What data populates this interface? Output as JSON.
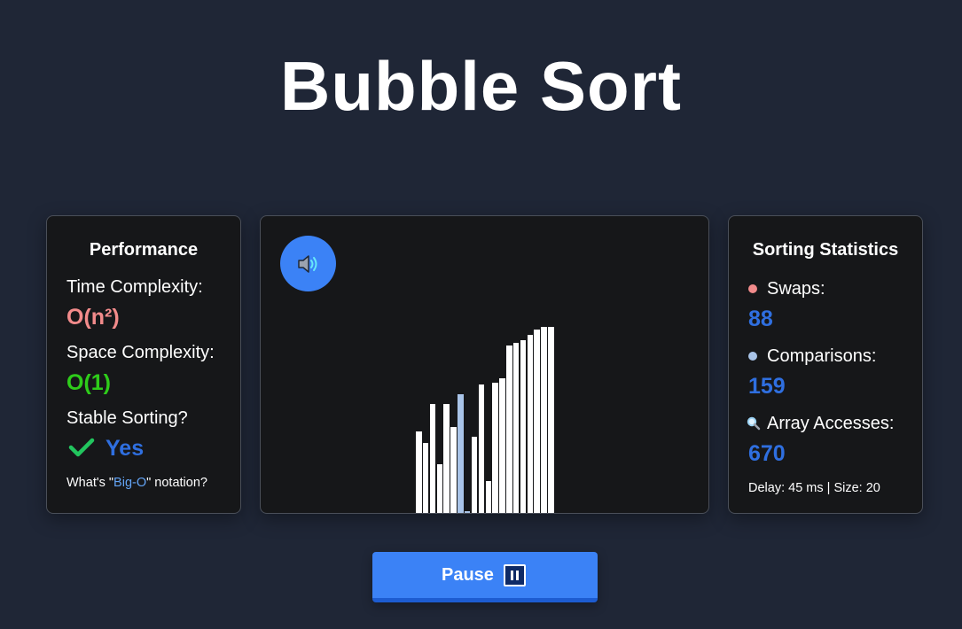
{
  "page_title": "Bubble Sort",
  "colors": {
    "background": "#1f2636",
    "panel": "#161719",
    "accent_blue": "#3b82f6",
    "value_blue": "#2f6fe0",
    "complexity_red": "#f28b8b",
    "complexity_green": "#2ecc1a",
    "bar": "#ffffff",
    "bar_highlight": "#a9c4e8",
    "swap_dot": "#f28b8b",
    "comparison_dot": "#a9c4e8"
  },
  "performance": {
    "heading": "Performance",
    "time_label": "Time Complexity:",
    "time_value": "O(n²)",
    "space_label": "Space Complexity:",
    "space_value": "O(1)",
    "stable_label": "Stable Sorting?",
    "stable_icon": "check-icon",
    "stable_value": "Yes",
    "bigo_prefix": "What's \"",
    "bigo_link": "Big-O",
    "bigo_suffix": "\" notation?"
  },
  "visualizer": {
    "sound_icon": "speaker-icon",
    "bars": [
      {
        "value": 92,
        "state": "default"
      },
      {
        "value": 79,
        "state": "default"
      },
      {
        "value": 123,
        "state": "default"
      },
      {
        "value": 55,
        "state": "default"
      },
      {
        "value": 123,
        "state": "default"
      },
      {
        "value": 97,
        "state": "default"
      },
      {
        "value": 134,
        "state": "compare"
      },
      {
        "value": 2,
        "state": "compare"
      },
      {
        "value": 86,
        "state": "default"
      },
      {
        "value": 145,
        "state": "default"
      },
      {
        "value": 36,
        "state": "default"
      },
      {
        "value": 147,
        "state": "default"
      },
      {
        "value": 152,
        "state": "default"
      },
      {
        "value": 189,
        "state": "default"
      },
      {
        "value": 192,
        "state": "default"
      },
      {
        "value": 195,
        "state": "default"
      },
      {
        "value": 201,
        "state": "default"
      },
      {
        "value": 207,
        "state": "default"
      },
      {
        "value": 210,
        "state": "default"
      },
      {
        "value": 210,
        "state": "default"
      }
    ]
  },
  "statistics": {
    "heading": "Sorting Statistics",
    "swaps_label": "Swaps:",
    "swaps_value": "88",
    "comparisons_label": "Comparisons:",
    "comparisons_value": "159",
    "accesses_icon": "magnifier-icon",
    "accesses_label": "Array Accesses:",
    "accesses_value": "670",
    "footer": "Delay: 45 ms | Size: 20"
  },
  "controls": {
    "pause_label": "Pause",
    "pause_icon": "pause-icon"
  }
}
